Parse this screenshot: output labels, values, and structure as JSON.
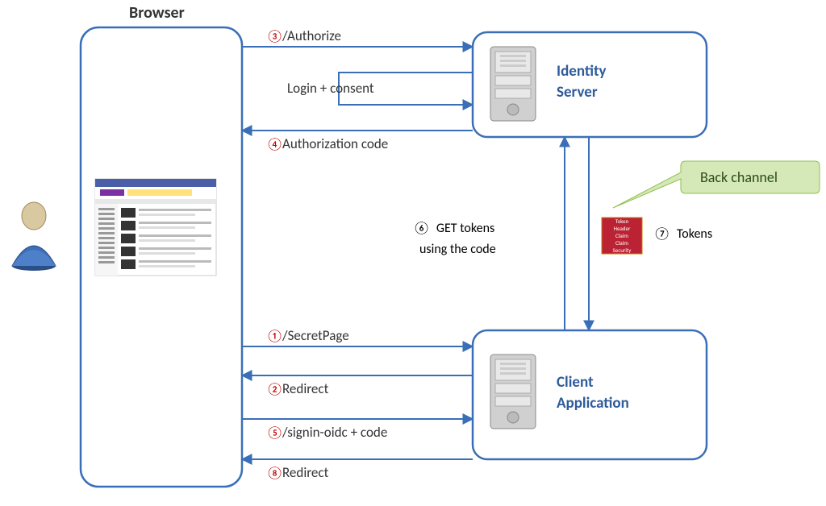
{
  "headings": {
    "browser": "Browser"
  },
  "nodes": {
    "identity_server": {
      "line1": "Identity",
      "line2": "Server"
    },
    "client_app": {
      "line1": "Client",
      "line2": "Application"
    }
  },
  "steps": {
    "s1": {
      "num": "①",
      "label": "/SecretPage"
    },
    "s2": {
      "num": "②",
      "label": "Redirect"
    },
    "s3": {
      "num": "③",
      "label": "/Authorize"
    },
    "s4": {
      "num": "④",
      "label": "Authorization code"
    },
    "s5": {
      "num": "⑤",
      "label": "/signin-oidc + code"
    },
    "s6": {
      "num": "⑥",
      "pre": "GET ",
      "tok": "tokens",
      "line2a": "using the ",
      "line2b": "code"
    },
    "s7": {
      "num": "⑦",
      "label": "Tokens"
    },
    "s8": {
      "num": "⑧",
      "label": "Redirect"
    },
    "login_consent": "Login + consent"
  },
  "callout": {
    "back_channel": "Back channel"
  },
  "token_rows": [
    "Token",
    "Header",
    "Claim",
    "Claim",
    "Security"
  ]
}
